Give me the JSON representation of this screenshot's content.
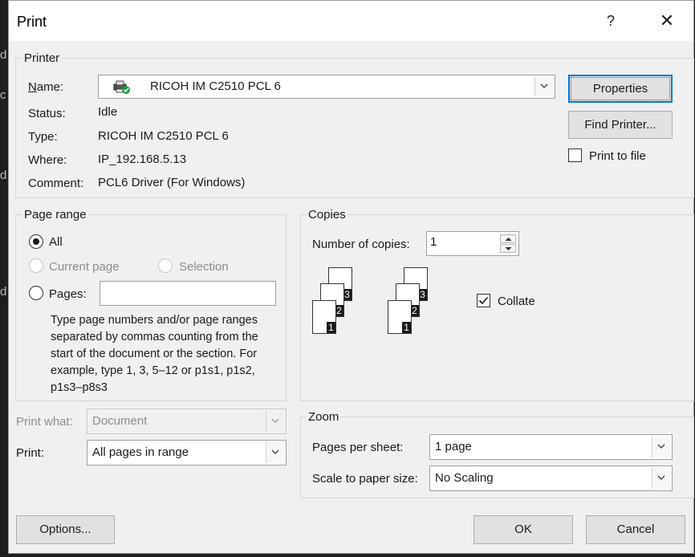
{
  "dialog": {
    "title": "Print",
    "help_label": "?",
    "close_label": "✕"
  },
  "printer": {
    "group_label": "Printer",
    "name_label": "Name:",
    "name_value": "RICOH IM C2510 PCL 6",
    "status_label": "Status:",
    "status_value": "Idle",
    "type_label": "Type:",
    "type_value": "RICOH IM C2510 PCL 6",
    "where_label": "Where:",
    "where_value": "IP_192.168.5.13",
    "comment_label": "Comment:",
    "comment_value": "PCL6 Driver (For Windows)",
    "properties_label": "Properties",
    "find_printer_label": "Find Printer...",
    "print_to_file_label": "Print to file",
    "print_to_file_checked": false
  },
  "page_range": {
    "group_label": "Page range",
    "all_label": "All",
    "current_page_label": "Current page",
    "selection_label": "Selection",
    "pages_label": "Pages:",
    "pages_value": "",
    "help_text": "Type page numbers and/or page ranges separated by commas counting from the start of the document or the section. For example, type 1, 3, 5–12 or p1s1, p1s2, p1s3–p8s3",
    "selected": "All"
  },
  "copies": {
    "group_label": "Copies",
    "number_label": "Number of copies:",
    "number_value": "1",
    "collate_label": "Collate",
    "collate_checked": true,
    "page_numbers": [
      "1",
      "2",
      "3"
    ]
  },
  "print_what": {
    "label": "Print what:",
    "value": "Document",
    "enabled": false
  },
  "print": {
    "label": "Print:",
    "value": "All pages in range"
  },
  "zoom": {
    "group_label": "Zoom",
    "pages_per_sheet_label": "Pages per sheet:",
    "pages_per_sheet_value": "1 page",
    "scale_label": "Scale to paper size:",
    "scale_value": "No Scaling"
  },
  "footer": {
    "options_label": "Options...",
    "ok_label": "OK",
    "cancel_label": "Cancel"
  },
  "colors": {
    "accent": "#0078d7",
    "check_green": "#1a9e3f",
    "dialog_bg": "#f0f0f0"
  },
  "icons": [
    "printer-icon",
    "dropdown-arrow-icon",
    "close-icon",
    "checkmark-icon",
    "spin-up-icon",
    "spin-down-icon"
  ]
}
